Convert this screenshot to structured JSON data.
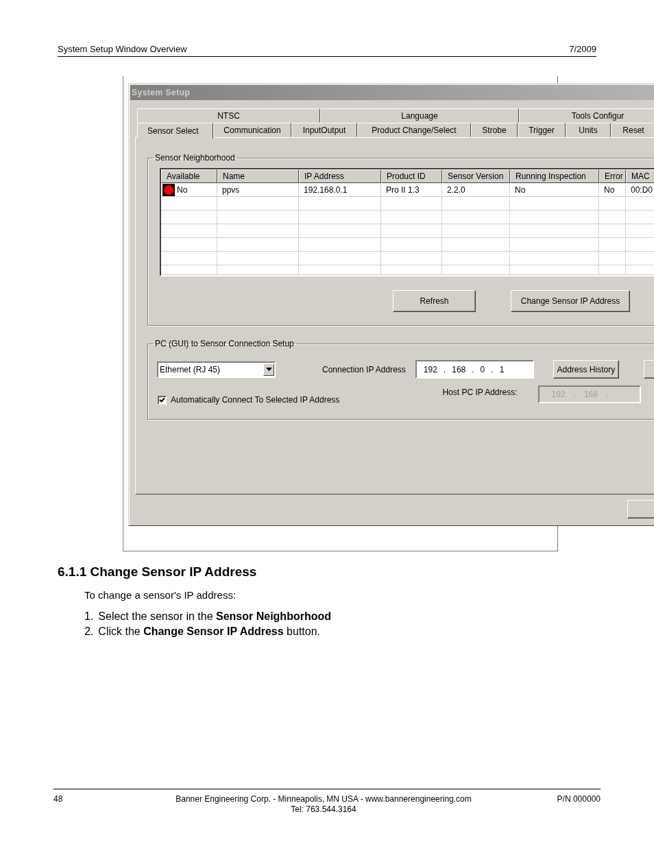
{
  "document_header": {
    "title": "System Setup Window Overview",
    "date": "7/2009"
  },
  "window": {
    "title": "System Setup",
    "tab_rows": [
      [
        {
          "label": "NTSC",
          "selected": false
        },
        {
          "label": "Language",
          "selected": false
        },
        {
          "label": "Tools Configur",
          "selected": false
        }
      ],
      [
        {
          "label": "Sensor Select",
          "selected": true
        },
        {
          "label": "Communication",
          "selected": false
        },
        {
          "label": "InputOutput",
          "selected": false
        },
        {
          "label": "Product Change/Select",
          "selected": false
        },
        {
          "label": "Strobe",
          "selected": false
        },
        {
          "label": "Trigger",
          "selected": false
        },
        {
          "label": "Units",
          "selected": false
        },
        {
          "label": "Reset",
          "selected": false
        }
      ]
    ],
    "sensor_neighborhood": {
      "title": "Sensor Neighborhood",
      "columns": [
        "Available",
        "Name",
        "IP Address",
        "Product ID",
        "Sensor Version",
        "Running Inspection",
        "Error",
        "MAC"
      ],
      "rows": [
        {
          "color": "#ff0000",
          "cells": [
            "No",
            "ppvs",
            "192.168.0.1",
            "Pro II 1.3",
            "2.2.0",
            "No",
            "No",
            "00:D0"
          ]
        }
      ],
      "buttons": [
        "Refresh",
        "Change Sensor IP Address"
      ]
    },
    "connection_setup": {
      "title": "PC (GUI) to Sensor Connection Setup",
      "interface": {
        "value": "Ethernet (RJ 45)"
      },
      "ip_label": "Connection IP Address",
      "ip_octets": [
        "192",
        "168",
        "0",
        "1"
      ],
      "separator": ".",
      "history_button": "Address History",
      "auto_connect": {
        "label": "Automatically Connect To Selected IP Address",
        "checked": true
      },
      "host_label": "Host PC IP Address:",
      "host_octets": [
        "192",
        "168"
      ],
      "host_disabled": true
    }
  },
  "heading": "6.1.1 Change Sensor IP Address",
  "intro": "To change a sensor's IP address:",
  "steps": [
    {
      "number": "1.",
      "text": "Select the sensor in the **Sensor Neighborhood**"
    },
    {
      "number": "2.",
      "text": "Click the **Change Sensor IP Address** button."
    }
  ],
  "footer": {
    "page": "48",
    "company": "Banner Engineering Corp. - Minneapolis, MN USA - www.bannerengineering.com",
    "phone": "Tel: 763.544.3164",
    "part_number": "P/N 000000"
  }
}
